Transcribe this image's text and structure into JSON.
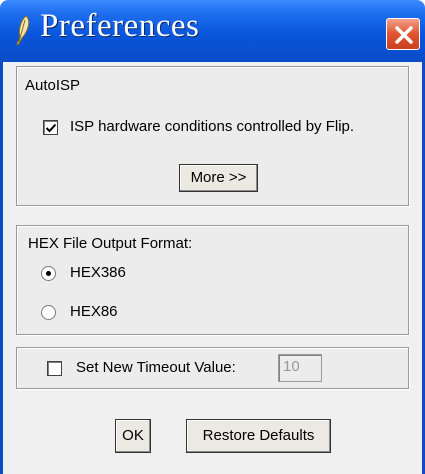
{
  "window": {
    "title": "Preferences",
    "icons": {
      "title": "feather-icon",
      "close": "close-icon"
    },
    "colors": {
      "titlebar": "#0b4cc7",
      "close_button": "#e0542f"
    }
  },
  "autoisp": {
    "group_label": "AutoISP",
    "isp_checkbox_label": "ISP hardware conditions controlled by Flip.",
    "isp_checked": true,
    "more_button": "More >>"
  },
  "hex": {
    "group_label": "HEX File Output Format:",
    "options": [
      {
        "label": "HEX386",
        "selected": true
      },
      {
        "label": "HEX86",
        "selected": false
      }
    ]
  },
  "timeout": {
    "checkbox_label": "Set New Timeout Value:",
    "checked": false,
    "value": "10"
  },
  "buttons": {
    "ok": "OK",
    "restore": "Restore Defaults"
  }
}
